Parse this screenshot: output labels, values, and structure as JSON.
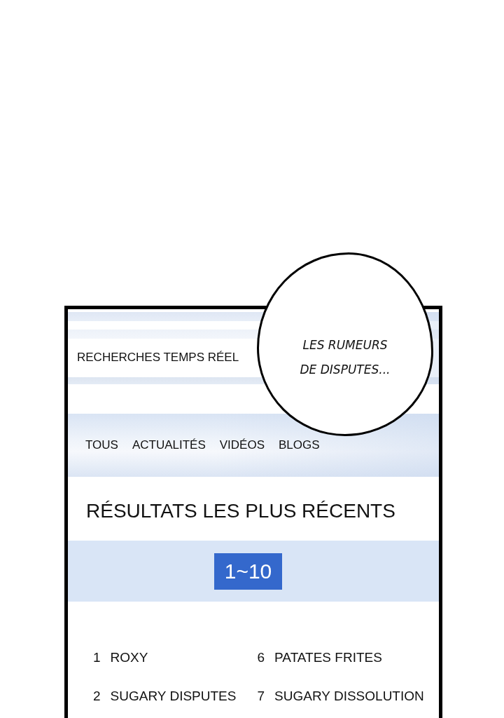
{
  "search_header": {
    "title": "RECHERCHES TEMPS RÉEL"
  },
  "tabs": [
    {
      "label": "TOUS"
    },
    {
      "label": "ACTUALITÉS"
    },
    {
      "label": "VIDÉOS"
    },
    {
      "label": "BLOGS"
    }
  ],
  "results_section": {
    "title": "RÉSULTATS LES PLUS RÉCENTS",
    "range_button": "1~10"
  },
  "results": {
    "columns": [
      [
        {
          "rank": "1",
          "keyword": "ROXY"
        },
        {
          "rank": "2",
          "keyword": "SUGARY DISPUTES"
        }
      ],
      [
        {
          "rank": "6",
          "keyword": "PATATES FRITES"
        },
        {
          "rank": "7",
          "keyword": "SUGARY DISSOLUTION"
        }
      ]
    ]
  },
  "speech_bubble": {
    "lines": [
      "LES RUMEURS",
      "DE DISPUTES..."
    ]
  }
}
